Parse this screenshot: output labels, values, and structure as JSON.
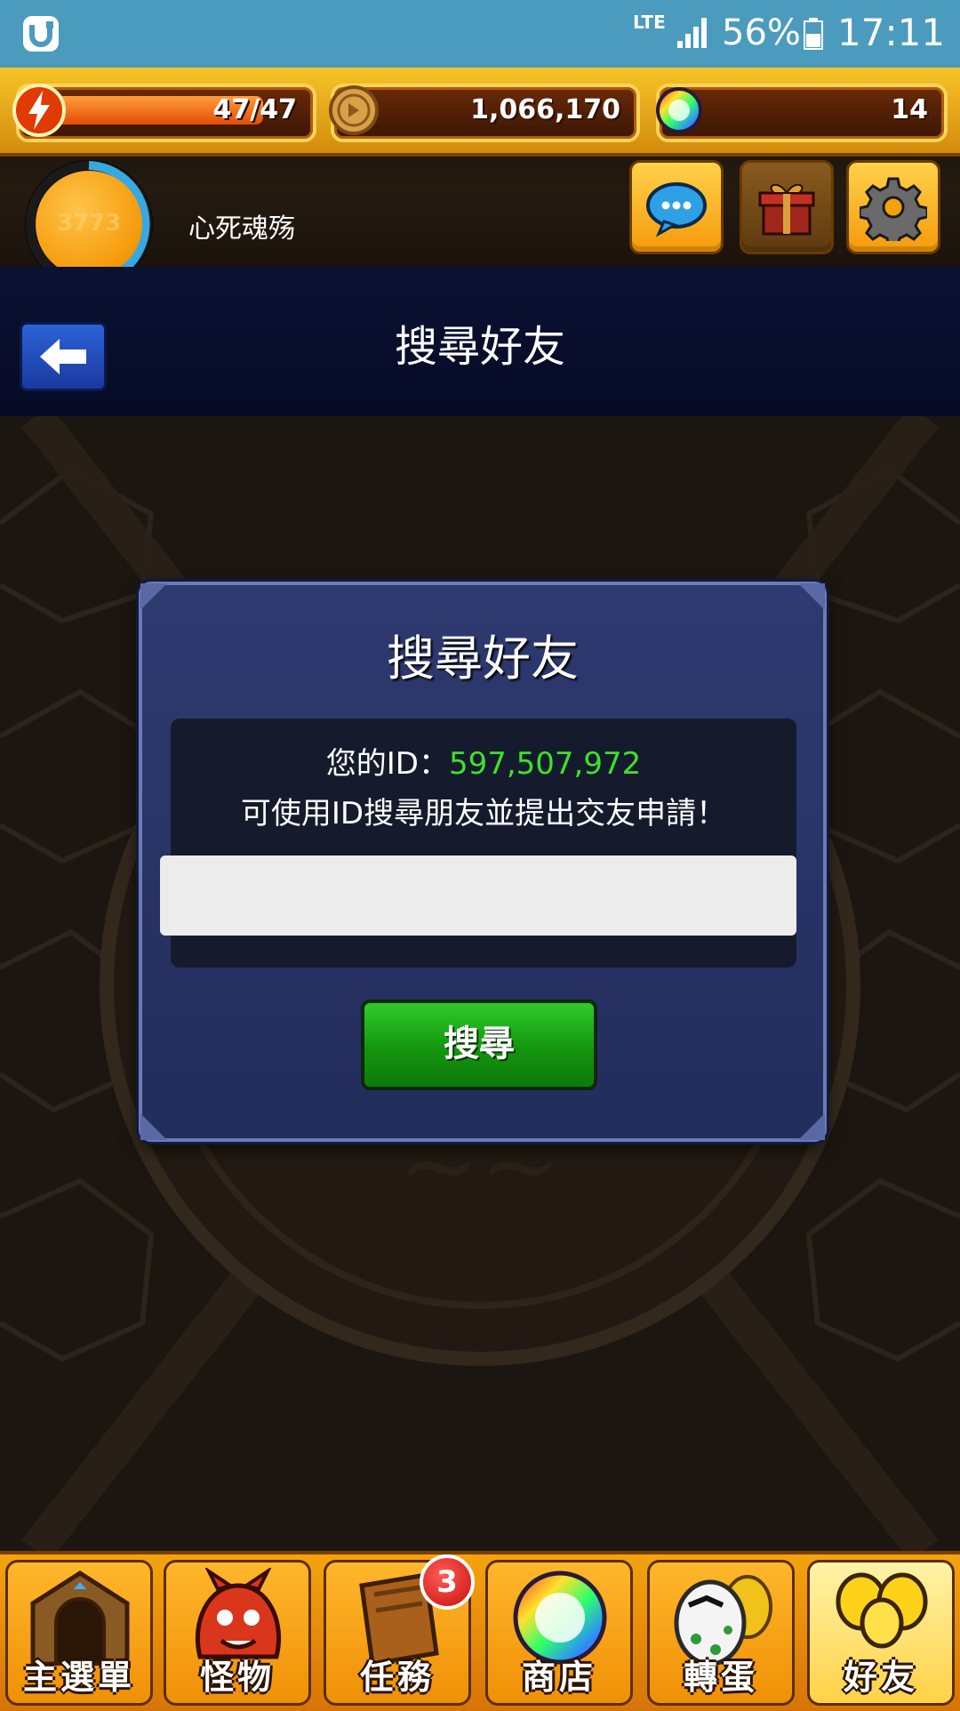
{
  "status_bar": {
    "network": "LTE",
    "battery_percent": "56%",
    "time": "17:11"
  },
  "header": {
    "energy": "47/47",
    "energy_level": 1.0,
    "coins": "1,066,170",
    "orbs": "14",
    "player_level": "3773",
    "username": "心死魂殇"
  },
  "title_bar": {
    "title": "搜尋好友"
  },
  "dialog": {
    "title": "搜尋好友",
    "id_label": "您的ID：",
    "id_value": "597,507,972",
    "hint": "可使用ID搜尋朋友並提出交友申請！",
    "input_value": "",
    "search_button": "搜尋"
  },
  "bottom_nav": {
    "items": [
      {
        "label": "主選單",
        "icon": "gate-icon"
      },
      {
        "label": "怪物",
        "icon": "monster-icon"
      },
      {
        "label": "任務",
        "icon": "quest-book-icon",
        "badge": "3"
      },
      {
        "label": "商店",
        "icon": "rainbow-orb-icon"
      },
      {
        "label": "轉蛋",
        "icon": "egg-icon"
      },
      {
        "label": "好友",
        "icon": "balloons-icon",
        "active": true
      }
    ]
  },
  "colors": {
    "id_value": "#3ee12b",
    "search_button": "#14950f",
    "dialog_bg": "#2e3a70",
    "nav_bg": "#f5a30f",
    "status_bar": "#4a9bbd"
  }
}
